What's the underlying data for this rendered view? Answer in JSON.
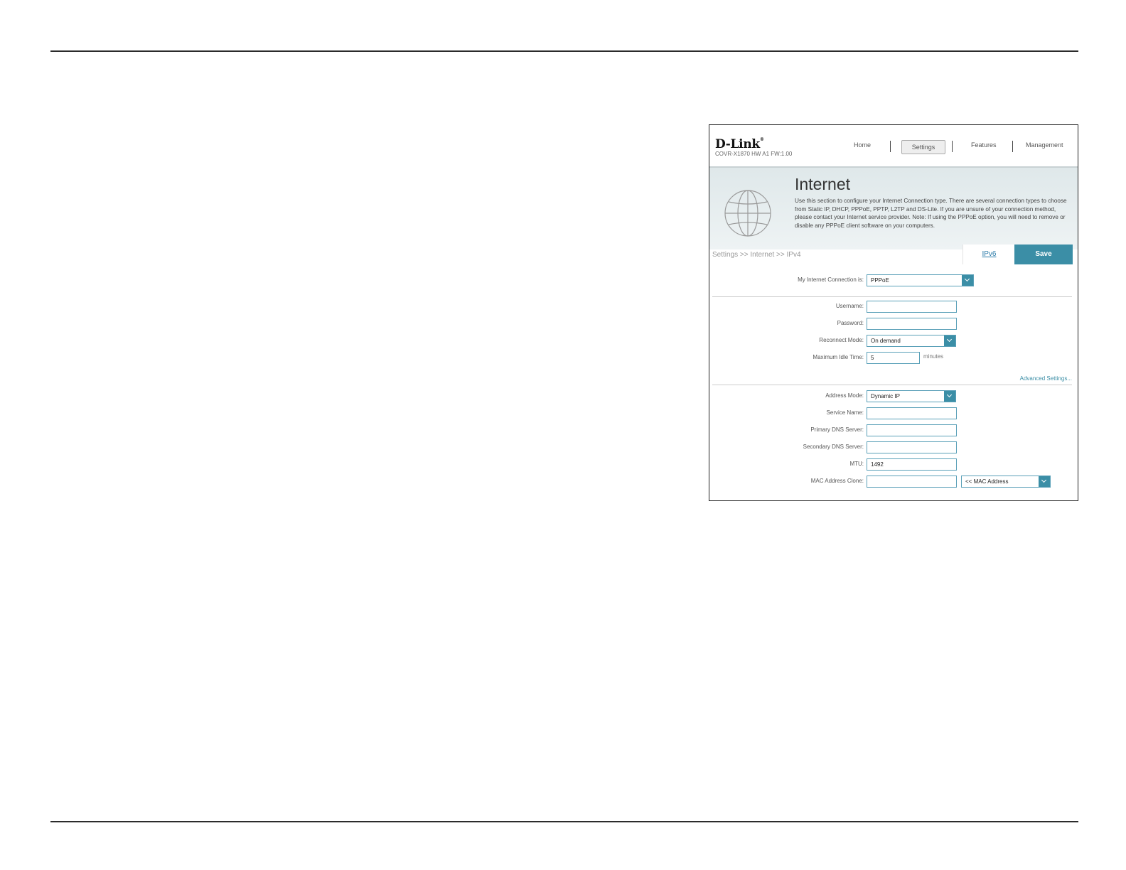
{
  "header": {
    "logo": "D-Link",
    "model": "COVR-X1870 HW A1 FW:1.00",
    "nav": [
      "Home",
      "Settings",
      "Features",
      "Management"
    ]
  },
  "banner": {
    "title": "Internet",
    "description": "Use this section to configure your Internet Connection type. There are several connection types to choose from Static IP, DHCP, PPPoE, PPTP, L2TP and DS-Lite. If you are unsure of your connection method, please contact your Internet service provider. Note: If using the PPPoE option, you will need to remove or disable any PPPoE client software on your computers."
  },
  "breadcrumb": "Settings >> Internet >> IPv4",
  "actions": {
    "ipv6": "IPv6",
    "save": "Save"
  },
  "form": {
    "connection_label": "My Internet Connection is:",
    "connection_value": "PPPoE",
    "username_label": "Username:",
    "username_value": "",
    "password_label": "Password:",
    "password_value": "",
    "reconnect_label": "Reconnect Mode:",
    "reconnect_value": "On demand",
    "idle_label": "Maximum Idle Time:",
    "idle_value": "5",
    "idle_unit": "minutes",
    "advanced_link": "Advanced Settings...",
    "address_mode_label": "Address Mode:",
    "address_mode_value": "Dynamic IP",
    "service_label": "Service Name:",
    "service_value": "",
    "primary_dns_label": "Primary DNS Server:",
    "primary_dns_value": "",
    "secondary_dns_label": "Secondary DNS Server:",
    "secondary_dns_value": "",
    "mtu_label": "MTU:",
    "mtu_value": "1492",
    "mac_label": "MAC Address Clone:",
    "mac_value": "",
    "mac_select": "<< MAC Address"
  }
}
